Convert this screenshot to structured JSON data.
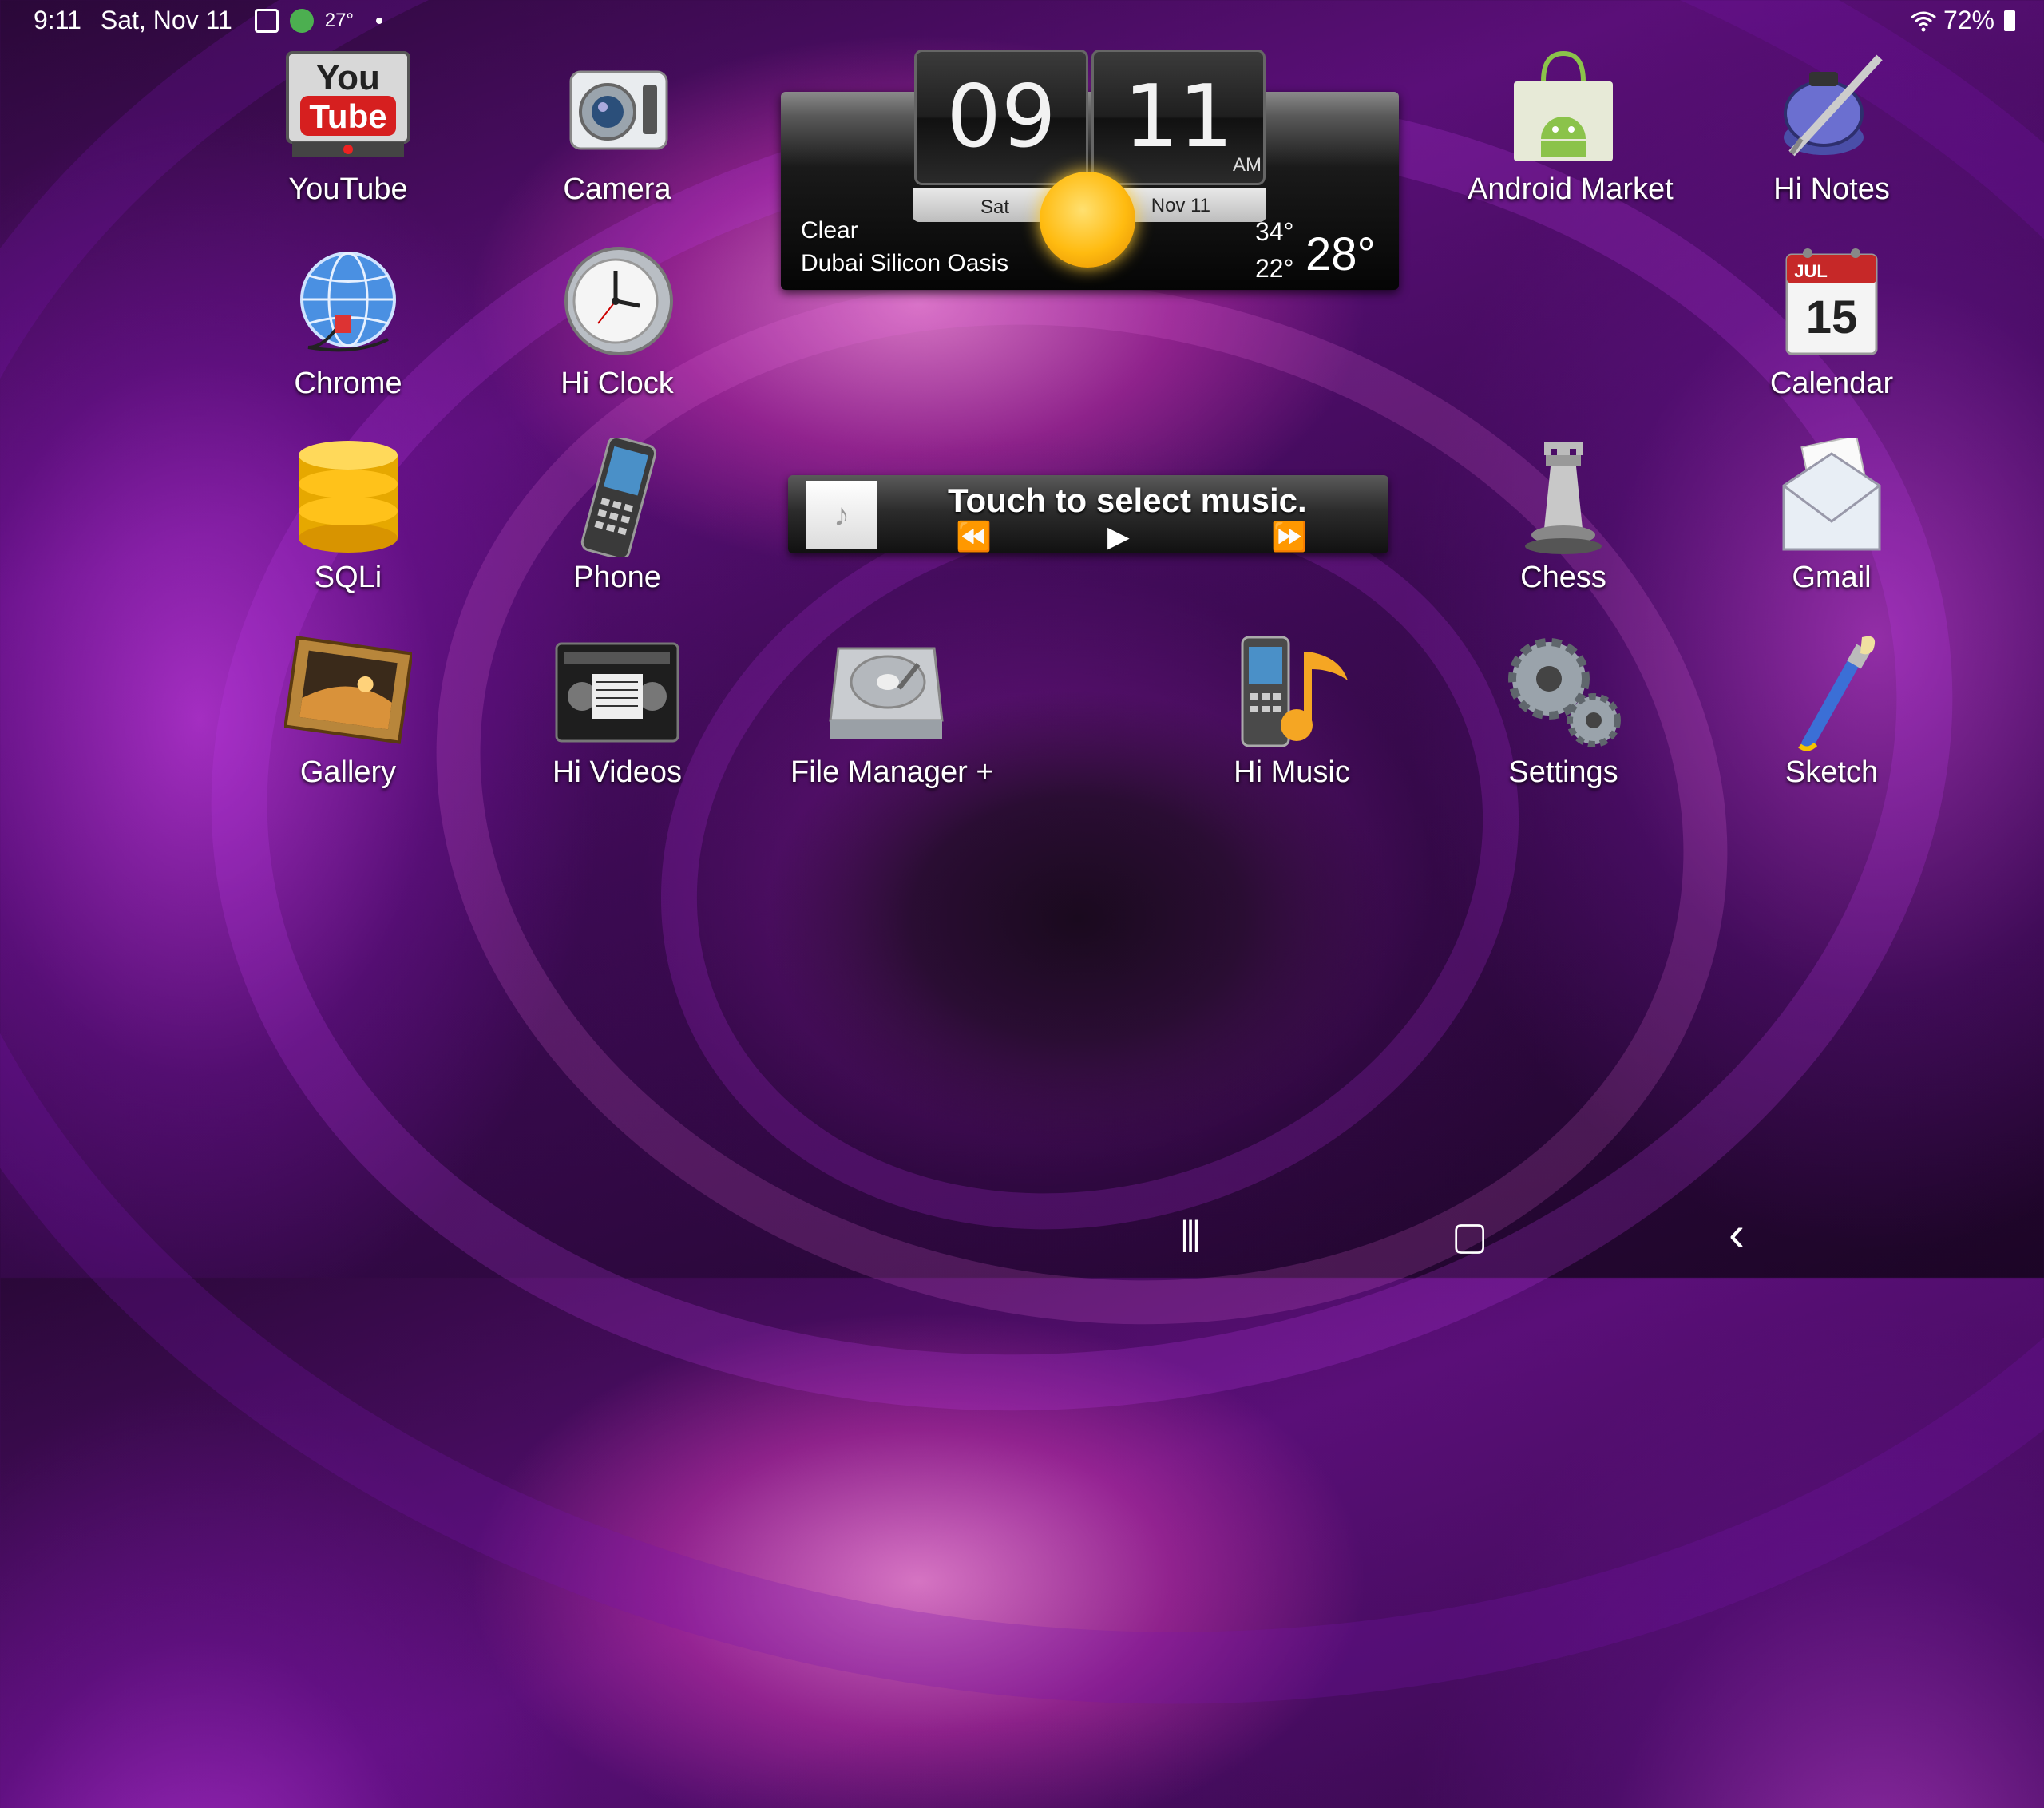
{
  "status_bar": {
    "time": "9:11",
    "date": "Sat, Nov 11",
    "weather_temp": "27°",
    "battery": "72%"
  },
  "weather_widget": {
    "hour": "09",
    "minute": "11",
    "ampm": "AM",
    "day": "Sat",
    "date": "Nov 11",
    "condition": "Clear",
    "location": "Dubai Silicon Oasis",
    "high": "34°",
    "low": "22°",
    "current": "28°"
  },
  "music_widget": {
    "title": "Touch to select music.",
    "thumb_glyph": "♪",
    "prev_glyph": "⏪",
    "play_glyph": "▶",
    "next_glyph": "⏩"
  },
  "apps": {
    "youtube": "YouTube",
    "camera": "Camera",
    "android_market": "Android Market",
    "hi_notes": "Hi Notes",
    "chrome": "Chrome",
    "hi_clock": "Hi Clock",
    "calendar": "Calendar",
    "sqli": "SQLi",
    "phone": "Phone",
    "chess": "Chess",
    "gmail": "Gmail",
    "gallery": "Gallery",
    "hi_videos": "Hi Videos",
    "file_manager": "File Manager +",
    "hi_music": "Hi Music",
    "settings": "Settings",
    "sketch": "Sketch"
  },
  "icons": {
    "youtube_you": "You",
    "youtube_tube": "Tube",
    "calendar_month": "JUL",
    "calendar_day": "15"
  },
  "navigation": {
    "recents": "|||",
    "home": "▢",
    "back": "‹"
  }
}
